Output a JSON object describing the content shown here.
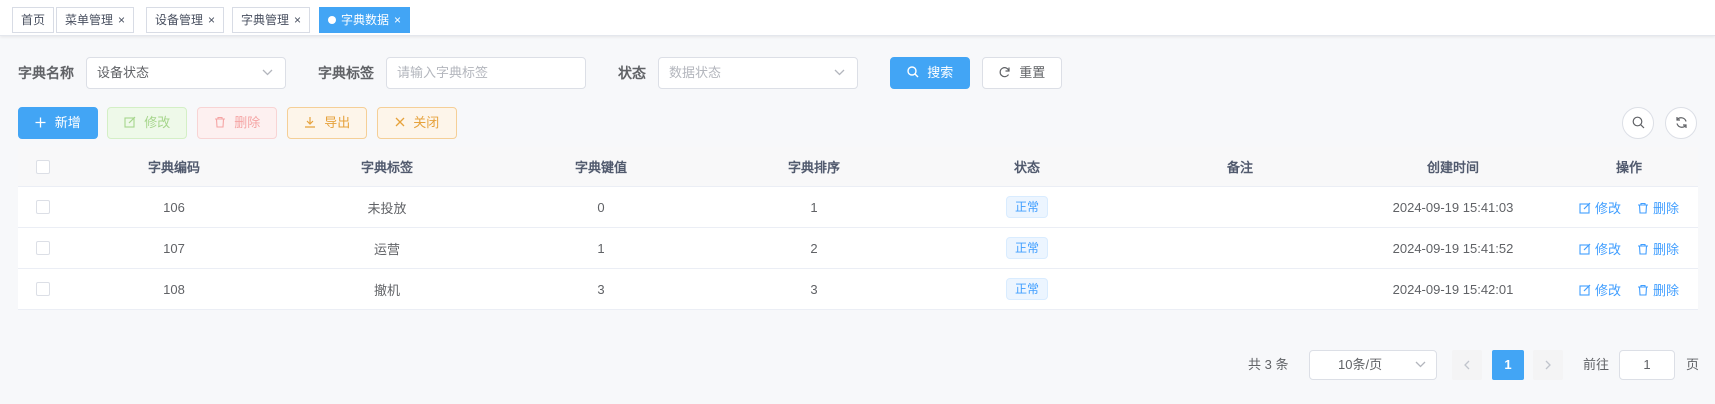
{
  "tags": [
    {
      "label": "首页",
      "closable": false,
      "active": false
    },
    {
      "label": "菜单管理",
      "closable": true,
      "active": false
    },
    {
      "label": "设备管理",
      "closable": true,
      "active": false
    },
    {
      "label": "字典管理",
      "closable": true,
      "active": false
    },
    {
      "label": "字典数据",
      "closable": true,
      "active": true
    }
  ],
  "tag_close_glyph": "×",
  "search": {
    "dict_name_label": "字典名称",
    "dict_name_value": "设备状态",
    "dict_label_label": "字典标签",
    "dict_label_placeholder": "请输入字典标签",
    "status_label": "状态",
    "status_placeholder": "数据状态",
    "search_button": "搜索",
    "reset_button": "重置"
  },
  "toolbar": {
    "add": "新增",
    "edit": "修改",
    "delete": "删除",
    "export": "导出",
    "close": "关闭"
  },
  "table": {
    "headers": [
      "字典编码",
      "字典标签",
      "字典键值",
      "字典排序",
      "状态",
      "备注",
      "创建时间",
      "操作"
    ],
    "rows": [
      {
        "code": "106",
        "label": "未投放",
        "value": "0",
        "sort": "1",
        "status": "正常",
        "remark": "",
        "created": "2024-09-19 15:41:03",
        "edit": "修改",
        "delete": "删除"
      },
      {
        "code": "107",
        "label": "运营",
        "value": "1",
        "sort": "2",
        "status": "正常",
        "remark": "",
        "created": "2024-09-19 15:41:52",
        "edit": "修改",
        "delete": "删除"
      },
      {
        "code": "108",
        "label": "撤机",
        "value": "3",
        "sort": "3",
        "status": "正常",
        "remark": "",
        "created": "2024-09-19 15:42:01",
        "edit": "修改",
        "delete": "删除"
      }
    ]
  },
  "pagination": {
    "total_text": "共 3 条",
    "page_size": "10条/页",
    "current_page": "1",
    "goto_prefix": "前往",
    "goto_value": "1",
    "goto_suffix": "页"
  },
  "colors": {
    "primary": "#42a5f5",
    "link": "#409eff"
  },
  "icons": [
    "close-icon",
    "dot-icon",
    "chevron-down-icon",
    "search-icon",
    "refresh-icon",
    "plus-icon",
    "edit-icon",
    "trash-icon",
    "download-icon",
    "x-icon",
    "chevron-left-icon",
    "chevron-right-icon"
  ]
}
